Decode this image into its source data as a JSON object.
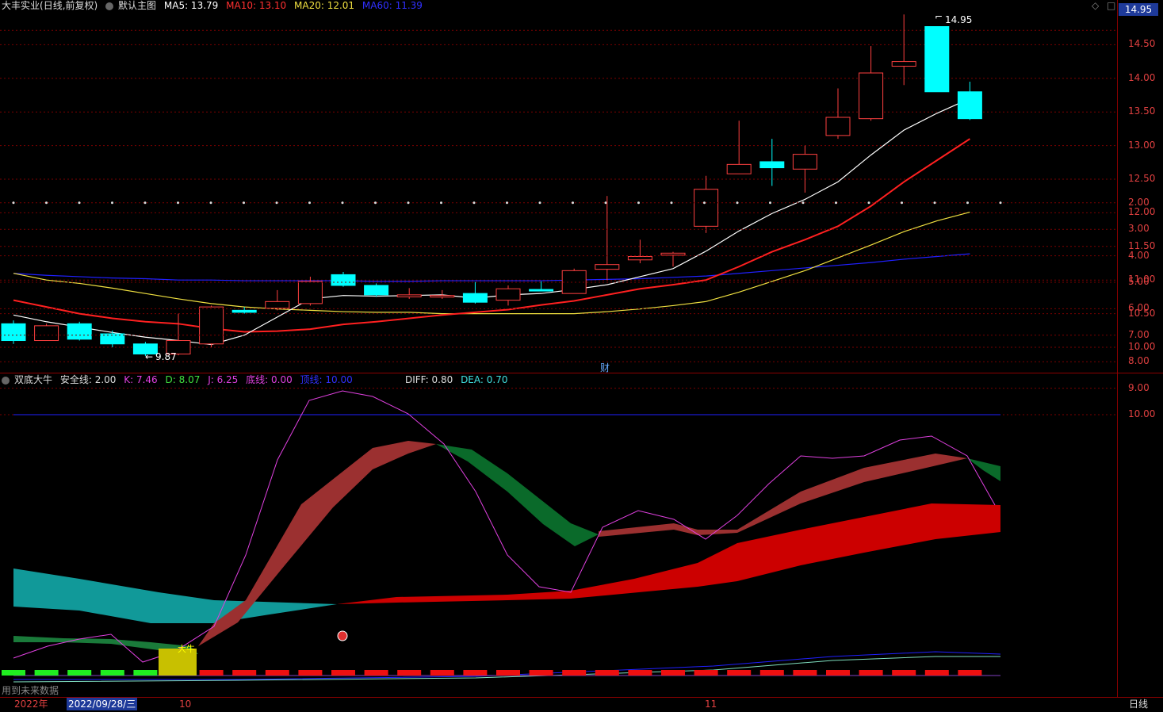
{
  "top_panel": {
    "stock_name": "大丰实业",
    "adjust": "(日线,前复权)",
    "main_chart": "默认主图",
    "ma5": "MA5: 13.79",
    "ma10": "MA10: 13.10",
    "ma20": "MA20: 12.01",
    "ma60": "MA60: 11.39",
    "current_price": "14.95",
    "high_label": "14.95",
    "low_label": "9.87",
    "fin_marker": "财",
    "y_ticks": [
      "14.50",
      "14.00",
      "13.50",
      "13.00",
      "12.50",
      "12.00",
      "11.50",
      "11.00",
      "10.50",
      "10.00"
    ],
    "colors": {
      "ma5": "#ffffff",
      "ma10": "#ff2020",
      "ma20": "#f0e040",
      "ma60": "#2020ff",
      "up": "#ff4040",
      "down": "#00ffff"
    }
  },
  "bottom_panel": {
    "indicator": "双底大牛",
    "safe_line": "安全线: 2.00",
    "k": "K: 7.46",
    "d": "D: 8.07",
    "j": "J: 6.25",
    "bottom_line": "底线: 0.00",
    "top_line": "顶线: 10.00",
    "diff": "DIFF: 0.80",
    "dea": "DEA: 0.70",
    "signal_label": "大牛",
    "y_ticks": [
      "10.00",
      "9.00",
      "8.00",
      "7.00",
      "6.00",
      "5.00",
      "4.00",
      "3.00",
      "2.00"
    ]
  },
  "footer": {
    "future_data": "用到未来数据",
    "year": "2022年",
    "date": "2022/09/28/三",
    "month_10": "10",
    "month_11": "11",
    "period": "日线"
  },
  "chart_data": {
    "type": "candlestick",
    "candles": [
      {
        "o": 10.35,
        "c": 10.1,
        "h": 10.4,
        "l": 10.05
      },
      {
        "o": 10.1,
        "c": 10.32,
        "h": 10.35,
        "l": 10.1
      },
      {
        "o": 10.35,
        "c": 10.12,
        "h": 10.38,
        "l": 10.1
      },
      {
        "o": 10.2,
        "c": 10.05,
        "h": 10.25,
        "l": 10.0
      },
      {
        "o": 10.05,
        "c": 9.9,
        "h": 10.08,
        "l": 9.87
      },
      {
        "o": 9.9,
        "c": 10.1,
        "h": 10.5,
        "l": 9.88
      },
      {
        "o": 10.05,
        "c": 10.6,
        "h": 10.62,
        "l": 10.0
      },
      {
        "o": 10.55,
        "c": 10.52,
        "h": 10.6,
        "l": 10.5
      },
      {
        "o": 10.58,
        "c": 10.68,
        "h": 10.85,
        "l": 10.55
      },
      {
        "o": 10.65,
        "c": 10.98,
        "h": 11.05,
        "l": 10.62
      },
      {
        "o": 11.08,
        "c": 10.92,
        "h": 11.12,
        "l": 10.9
      },
      {
        "o": 10.92,
        "c": 10.78,
        "h": 10.95,
        "l": 10.75
      },
      {
        "o": 10.75,
        "c": 10.78,
        "h": 10.88,
        "l": 10.72
      },
      {
        "o": 10.75,
        "c": 10.77,
        "h": 10.85,
        "l": 10.72
      },
      {
        "o": 10.8,
        "c": 10.67,
        "h": 10.97,
        "l": 10.65
      },
      {
        "o": 10.7,
        "c": 10.87,
        "h": 10.92,
        "l": 10.62
      },
      {
        "o": 10.86,
        "c": 10.84,
        "h": 10.98,
        "l": 10.84
      },
      {
        "o": 10.8,
        "c": 11.14,
        "h": 11.17,
        "l": 10.8
      },
      {
        "o": 11.16,
        "c": 11.23,
        "h": 12.25,
        "l": 11.0
      },
      {
        "o": 11.3,
        "c": 11.35,
        "h": 11.6,
        "l": 11.25
      },
      {
        "o": 11.37,
        "c": 11.4,
        "h": 11.42,
        "l": 11.2
      },
      {
        "o": 11.8,
        "c": 12.35,
        "h": 12.55,
        "l": 11.7
      },
      {
        "o": 12.58,
        "c": 12.72,
        "h": 13.37,
        "l": 12.58
      },
      {
        "o": 12.76,
        "c": 12.67,
        "h": 13.1,
        "l": 12.4
      },
      {
        "o": 12.65,
        "c": 12.87,
        "h": 13.0,
        "l": 12.3
      },
      {
        "o": 13.15,
        "c": 13.42,
        "h": 13.85,
        "l": 13.1
      },
      {
        "o": 13.4,
        "c": 14.08,
        "h": 14.48,
        "l": 13.37
      },
      {
        "o": 14.18,
        "c": 14.25,
        "h": 14.95,
        "l": 13.9
      },
      {
        "o": 14.77,
        "c": 13.8,
        "h": 14.77,
        "l": 13.8
      },
      {
        "o": 13.8,
        "c": 13.4,
        "h": 13.95,
        "l": 13.38
      }
    ],
    "ma5": [
      10.48,
      10.38,
      10.3,
      10.22,
      10.15,
      10.1,
      10.04,
      10.18,
      10.45,
      10.72,
      10.77,
      10.76,
      10.77,
      10.78,
      10.73,
      10.78,
      10.8,
      10.86,
      10.93,
      11.05,
      11.17,
      11.43,
      11.73,
      11.99,
      12.2,
      12.46,
      12.86,
      13.23,
      13.48,
      13.7
    ],
    "ma10": [
      10.7,
      10.6,
      10.5,
      10.43,
      10.38,
      10.35,
      10.28,
      10.23,
      10.24,
      10.27,
      10.34,
      10.38,
      10.43,
      10.48,
      10.52,
      10.56,
      10.63,
      10.69,
      10.78,
      10.87,
      10.93,
      11.0,
      11.2,
      11.42,
      11.6,
      11.8,
      12.1,
      12.46,
      12.78,
      13.1
    ],
    "ma20": [
      11.1,
      11.0,
      10.95,
      10.88,
      10.8,
      10.72,
      10.65,
      10.6,
      10.57,
      10.55,
      10.53,
      10.52,
      10.52,
      10.5,
      10.5,
      10.5,
      10.5,
      10.5,
      10.53,
      10.57,
      10.62,
      10.68,
      10.82,
      10.98,
      11.14,
      11.33,
      11.52,
      11.72,
      11.88,
      12.01
    ],
    "ma60": [
      11.1,
      11.07,
      11.05,
      11.03,
      11.02,
      11.0,
      11.0,
      10.99,
      10.99,
      10.99,
      10.99,
      10.98,
      10.98,
      10.99,
      10.99,
      10.99,
      10.99,
      11.0,
      11.01,
      11.02,
      11.04,
      11.06,
      11.1,
      11.14,
      11.18,
      11.22,
      11.26,
      11.31,
      11.35,
      11.39
    ]
  }
}
